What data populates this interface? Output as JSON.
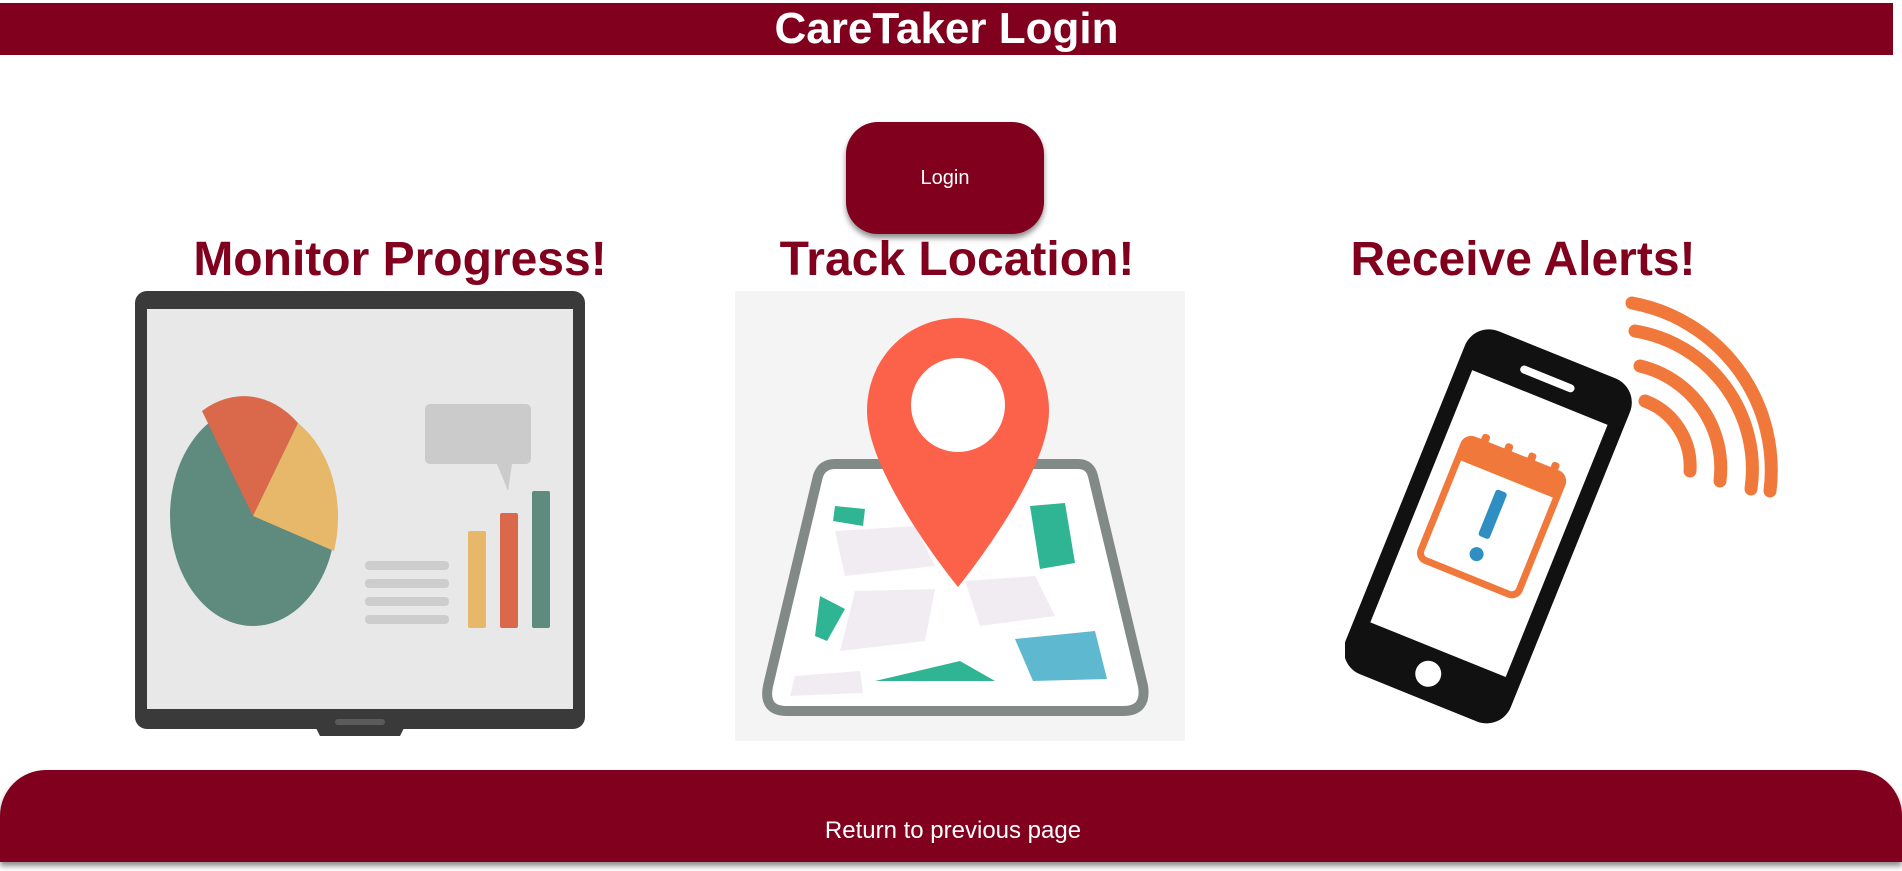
{
  "header": {
    "title": "CareTaker Login"
  },
  "login": {
    "label": "Login"
  },
  "features": [
    {
      "title": "Monitor Progress!",
      "icon": "presentation-chart-icon"
    },
    {
      "title": "Track Location!",
      "icon": "map-pin-icon"
    },
    {
      "title": "Receive Alerts!",
      "icon": "phone-alert-icon"
    }
  ],
  "footer": {
    "return_label": "Return to previous page"
  },
  "colors": {
    "brand": "#80001e",
    "pin": "#ff6347",
    "chart_green": "#5f8a7e",
    "chart_orange": "#d9694a",
    "chart_yellow": "#e7b86a",
    "alert_orange": "#f0783a",
    "alert_blue": "#2f8fc2"
  }
}
